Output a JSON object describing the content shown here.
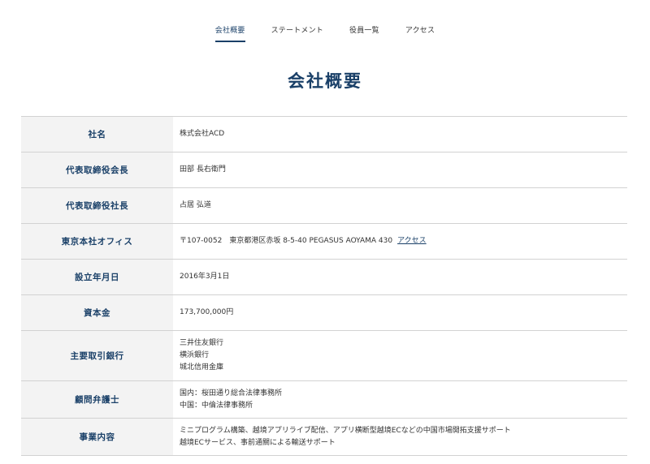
{
  "subnav": {
    "items": [
      "会社概要",
      "ステートメント",
      "役員一覧",
      "アクセス"
    ]
  },
  "page_title": "会社概要",
  "company": {
    "rows": [
      {
        "label": "社名",
        "value": "株式会社ACD"
      },
      {
        "label": "代表取締役会長",
        "value": "田部 長右衛門"
      },
      {
        "label": "代表取締役社長",
        "value": "占居 弘道"
      },
      {
        "label": "東京本社オフィス",
        "value": "〒107-0052　東京都港区赤坂 8-5-40 PEGASUS AOYAMA 430",
        "link": "アクセス"
      },
      {
        "label": "設立年月日",
        "value": "2016年3月1日"
      },
      {
        "label": "資本金",
        "value": "173,700,000円"
      },
      {
        "label": "主要取引銀行",
        "lines": [
          "三井住友銀行",
          "横浜銀行",
          "城北信用金庫"
        ]
      },
      {
        "label": "顧問弁護士",
        "lines": [
          "国内：桜田通り総合法律事務所",
          "中国：中倫法律事務所"
        ]
      },
      {
        "label": "事業内容",
        "lines": [
          "ミニプログラム構築、越境アプリライブ配信、アプリ横断型越境ECなどの中国市場開拓支援サポート",
          "越境ECサービス、事前通關による輸送サポート"
        ]
      }
    ]
  }
}
